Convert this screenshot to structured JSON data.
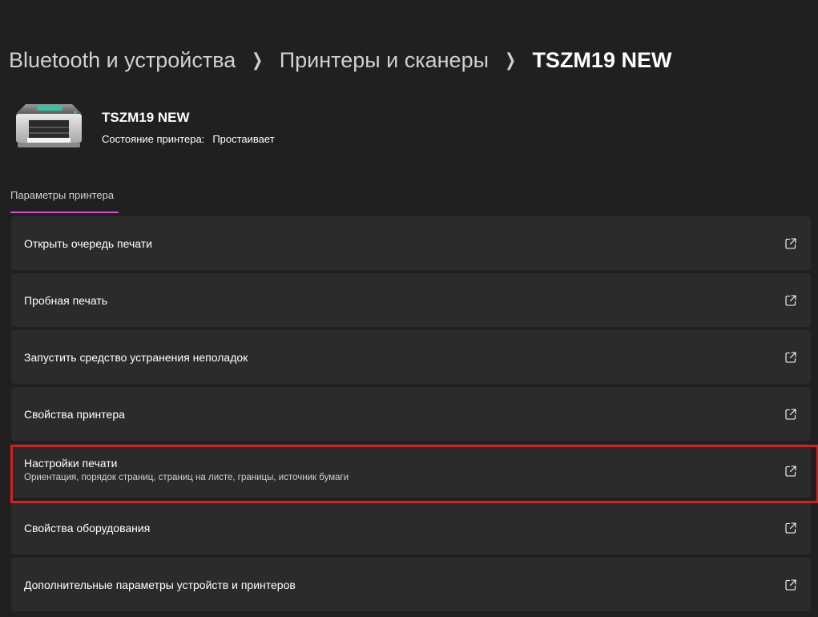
{
  "breadcrumb": {
    "items": [
      {
        "label": "Bluetooth и устройства"
      },
      {
        "label": "Принтеры и сканеры"
      }
    ],
    "current": "TSZM19 NEW"
  },
  "printer": {
    "name": "TSZM19 NEW",
    "status_label": "Состояние принтера:",
    "status_value": "Простаивает",
    "icon": "printer-icon"
  },
  "section": {
    "title": "Параметры принтера",
    "accent_color": "#d84cd8"
  },
  "settings": [
    {
      "label": "Открыть очередь печати",
      "icon": "open-external-icon"
    },
    {
      "label": "Пробная печать",
      "icon": "open-external-icon"
    },
    {
      "label": "Запустить средство устранения неполадок",
      "icon": "open-external-icon"
    },
    {
      "label": "Свойства принтера",
      "icon": "open-external-icon"
    },
    {
      "label": "Настройки печати",
      "description": "Ориентация, порядок страниц, страниц на листе, границы, источник бумаги",
      "icon": "open-external-icon",
      "highlighted": true
    },
    {
      "label": "Свойства оборудования",
      "icon": "open-external-icon"
    },
    {
      "label": "Дополнительные параметры устройств и принтеров",
      "icon": "open-external-icon"
    }
  ],
  "colors": {
    "background": "#202020",
    "card": "#2b2b2b",
    "highlight_border": "#d42020"
  }
}
